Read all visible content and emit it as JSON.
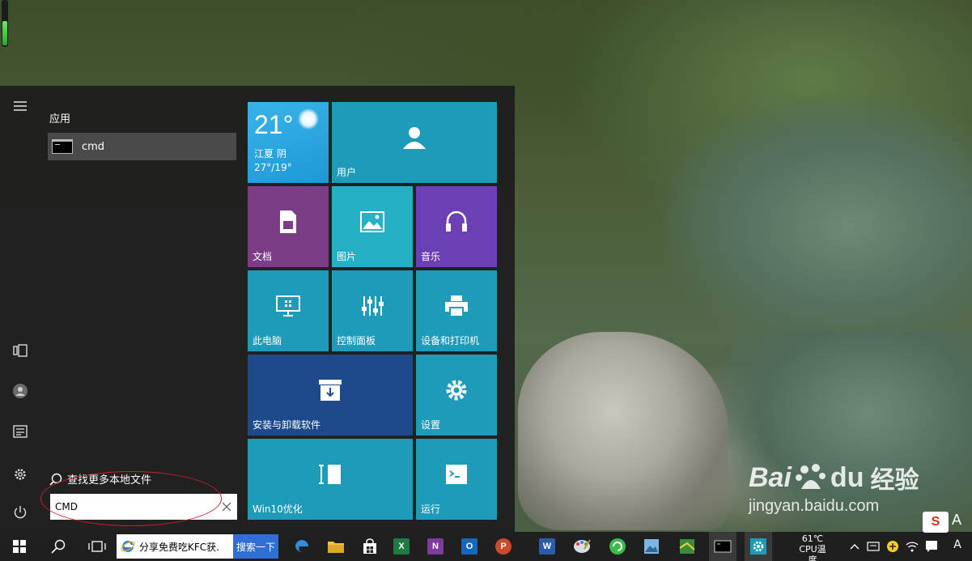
{
  "desktop": {
    "progress_level": 0.55,
    "watermark_brand": "Bai",
    "watermark_cn": "经验",
    "watermark_url": "jingyan.baidu.com"
  },
  "start_menu": {
    "section_title": "应用",
    "results": [
      {
        "label": "cmd",
        "icon": "command-prompt-icon"
      }
    ],
    "search_more_label": "查找更多本地文件",
    "search": {
      "value": "CMD",
      "placeholder": ""
    },
    "rail": [
      "hamburger-menu-icon",
      "tablet-mode-icon",
      "user-account-icon",
      "documents-icon",
      "settings-icon",
      "power-icon"
    ],
    "tiles": {
      "weather": {
        "temp": "21°",
        "city": "江夏 阴",
        "range": "27°/19°"
      },
      "user": "用户",
      "documents": "文档",
      "pictures": "图片",
      "music": "音乐",
      "this_pc": "此电脑",
      "control_panel": "控制面板",
      "devices_printers": "设备和打印机",
      "uninstall": "安装与卸载软件",
      "settings": "设置",
      "win10opt": "Win10优化",
      "run": "运行"
    }
  },
  "taskbar": {
    "ie_text": "分享免费吃KFC获...",
    "ie_search": "搜索一下",
    "cpu_temp": "61℃",
    "cpu_label": "CPU温度",
    "input_method": "A",
    "colors": {
      "taskbar": "#1f1f1f",
      "tile": "#1e9bb8",
      "dark_tile": "#1d5799",
      "purple_tile": "#6e3f8f",
      "violet_tile": "#5f3aa8"
    }
  }
}
